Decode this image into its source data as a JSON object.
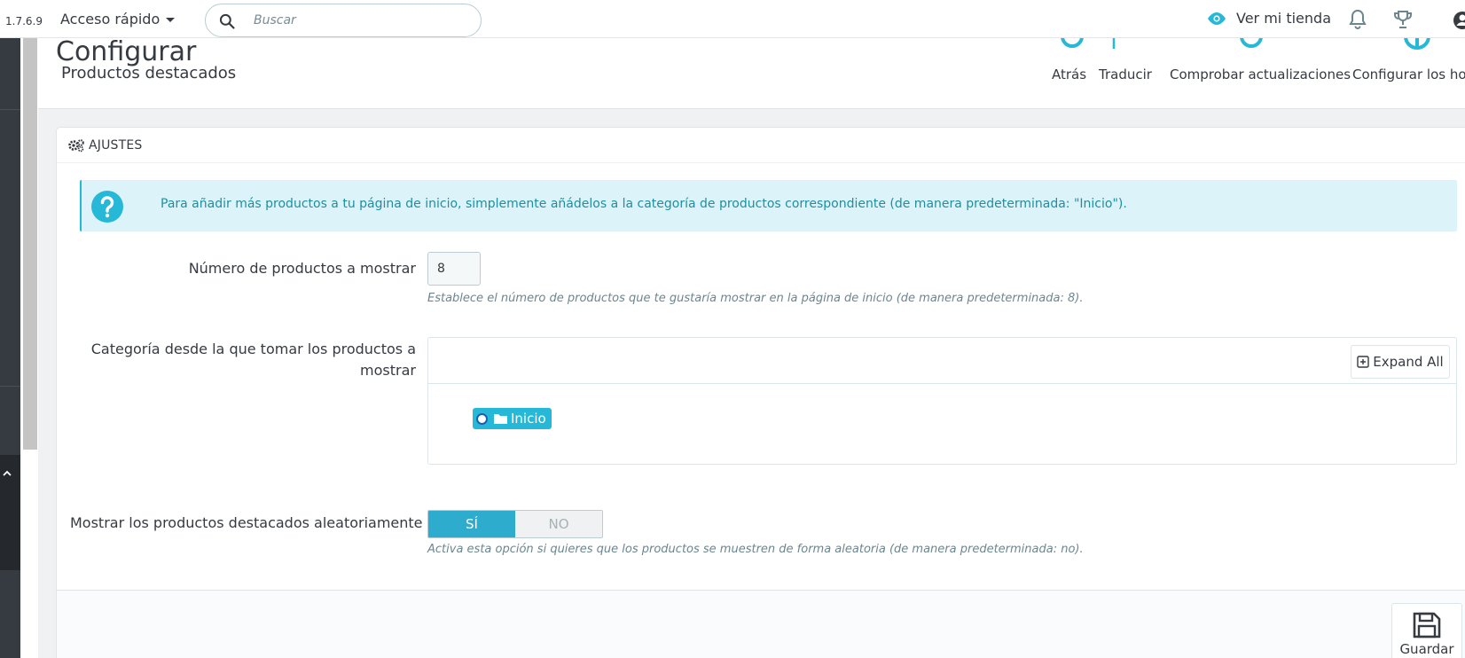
{
  "header": {
    "version": "1.7.6.9",
    "quick_access_label": "Acceso rápido",
    "search_placeholder": "Buscar",
    "view_shop_label": "Ver mi tienda"
  },
  "page": {
    "title": "Configurar",
    "subtitle": "Productos destacados"
  },
  "toolbar": {
    "back_label": "Atrás",
    "translate_label": "Traducir",
    "check_updates_label": "Comprobar actualizaciones",
    "hooks_label": "Configurar los hooks"
  },
  "panel": {
    "heading": "AJUSTES",
    "alert_text": "Para añadir más productos a tu página de inicio, simplemente añádelos a la categoría de productos correspondiente (de manera predeterminada: \"Inicio\").",
    "fields": {
      "nb_products": {
        "label": "Número de productos a mostrar",
        "value": "8",
        "help": "Establece el número de productos que te gustaría mostrar en la página de inicio (de manera predeterminada: 8)."
      },
      "category": {
        "label": "Categoría desde la que tomar los productos a mostrar",
        "expand_label": "Expand All",
        "root_node": "Inicio"
      },
      "random": {
        "label": "Mostrar los productos destacados aleatoriamente",
        "yes_label": "SÍ",
        "no_label": "NO",
        "help": "Activa esta opción si quieres que los productos se muestren de forma aleatoria (de manera predeterminada: no)."
      }
    },
    "save_label": "Guardar"
  },
  "colors": {
    "accent": "#25b9d7",
    "sidebar": "#363a41",
    "alert_bg": "#dcf4f9"
  }
}
